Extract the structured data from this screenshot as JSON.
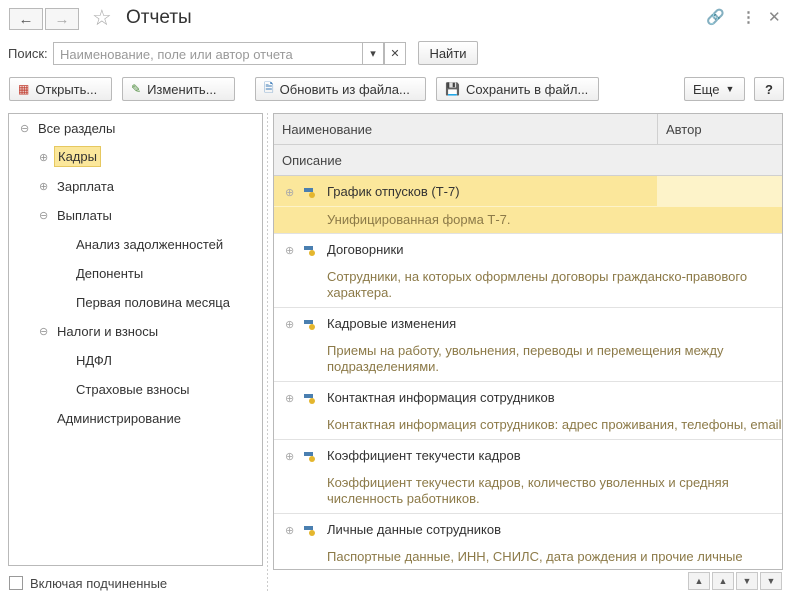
{
  "window": {
    "title": "Отчеты"
  },
  "search": {
    "label": "Поиск:",
    "placeholder": "Наименование, поле или автор отчета",
    "find_button": "Найти"
  },
  "toolbar": {
    "open": "Открыть...",
    "edit": "Изменить...",
    "update_from_file": "Обновить из файла...",
    "save_to_file": "Сохранить в файл...",
    "more": "Еще",
    "help": "?"
  },
  "tree": {
    "root": "Все разделы",
    "items": [
      {
        "label": "Кадры"
      },
      {
        "label": "Зарплата"
      },
      {
        "label": "Выплаты"
      },
      {
        "label": "Анализ задолженностей"
      },
      {
        "label": "Депоненты"
      },
      {
        "label": "Первая половина месяца"
      },
      {
        "label": "Налоги и взносы"
      },
      {
        "label": "НДФЛ"
      },
      {
        "label": "Страховые взносы"
      },
      {
        "label": "Администрирование"
      }
    ]
  },
  "grid": {
    "columns": {
      "name": "Наименование",
      "author": "Автор",
      "description": "Описание"
    },
    "rows": [
      {
        "name": "График отпусков (Т-7)",
        "description": "Унифицированная форма Т-7."
      },
      {
        "name": "Договорники",
        "description": "Сотрудники, на которых оформлены договоры гражданско-правового характера."
      },
      {
        "name": "Кадровые изменения",
        "description": "Приемы на работу, увольнения, переводы и перемещения между подразделениями."
      },
      {
        "name": "Контактная информация сотрудников",
        "description": "Контактная информация сотрудников: адрес проживания, телефоны, email."
      },
      {
        "name": "Коэффициент текучести кадров",
        "description": "Коэффициент текучести кадров, количество уволенных и средняя численность работников."
      },
      {
        "name": "Личные данные сотрудников",
        "description": "Паспортные данные, ИНН, СНИЛС, дата рождения и прочие личные"
      }
    ]
  },
  "footer": {
    "include_subordinate": "Включая подчиненные"
  },
  "colors": {
    "selection": "#fbe79b",
    "description_text": "#8c7a48"
  }
}
